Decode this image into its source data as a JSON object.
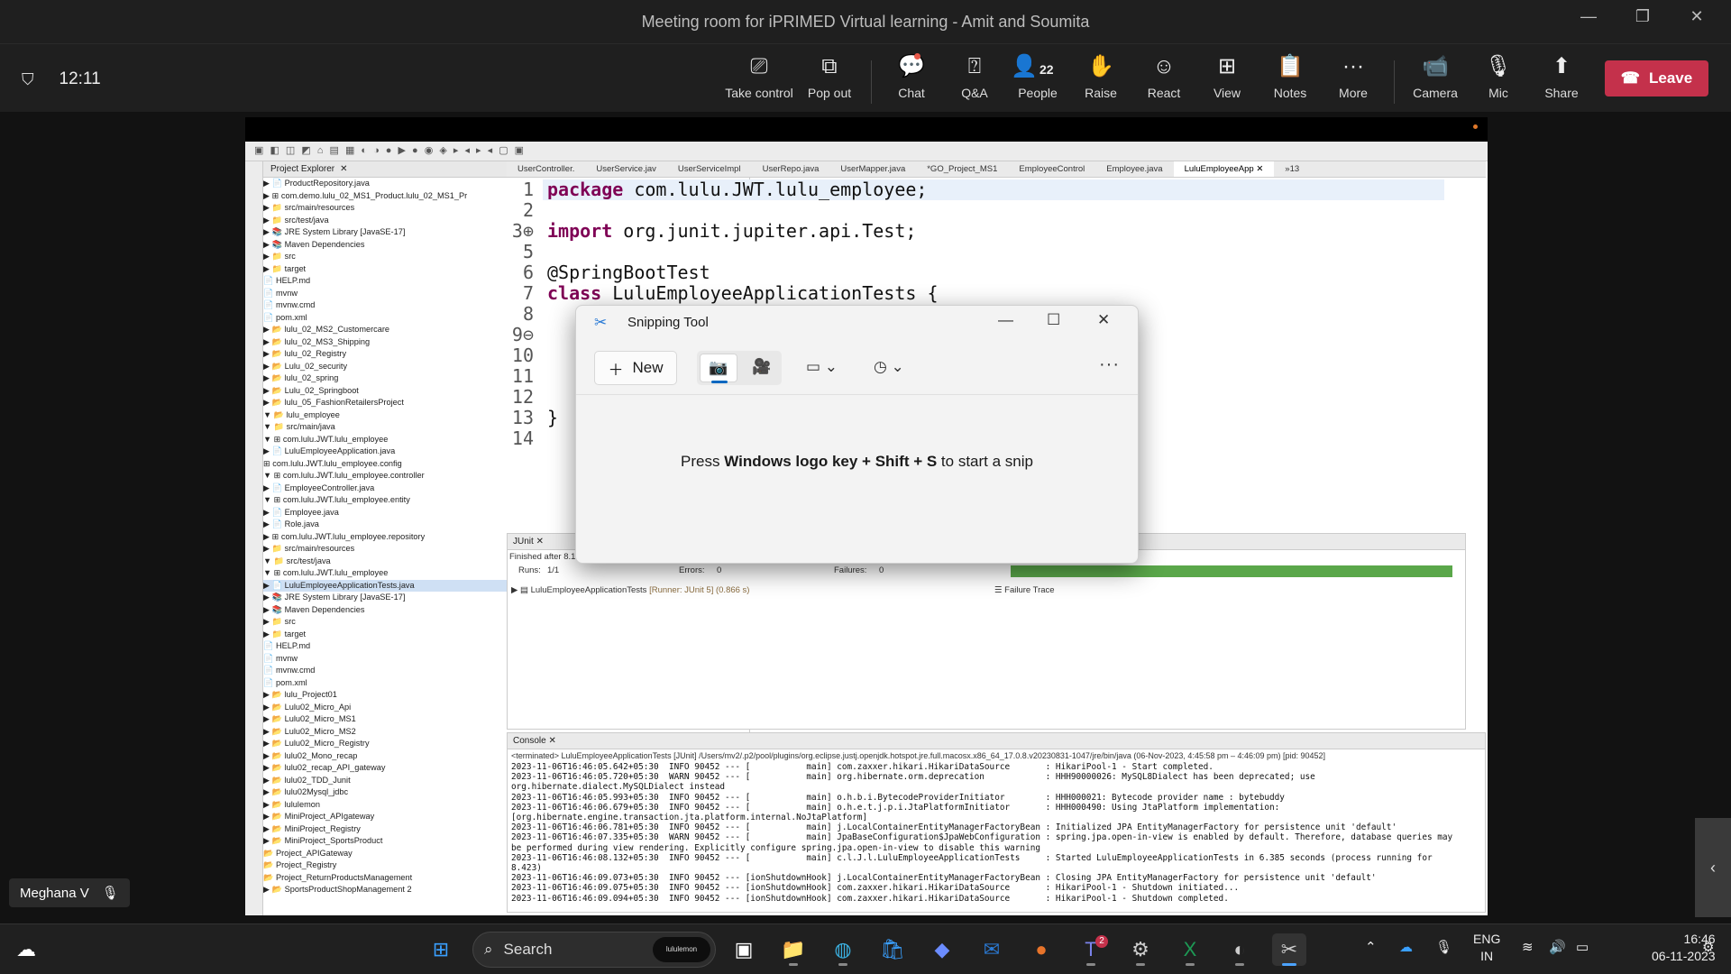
{
  "window": {
    "title": "Meeting room for iPRIMED Virtual learning - Amit and Soumita",
    "min": "—",
    "max": "❐",
    "close": "✕"
  },
  "meeting": {
    "elapsed": "12:11"
  },
  "controls": {
    "take_control": "Take control",
    "pop_out": "Pop out",
    "chat": "Chat",
    "qa": "Q&A",
    "people": "People",
    "people_count": "22",
    "raise": "Raise",
    "react": "React",
    "view": "View",
    "notes": "Notes",
    "more": "More",
    "camera": "Camera",
    "mic": "Mic",
    "share": "Share",
    "leave": "Leave"
  },
  "participant": {
    "name": "Meghana V"
  },
  "eclipse": {
    "toolbar": "▣ ◧ ◫ ◩ ⌂ ▤ ▦ ◐ ◑ ● ▶ ● ◉ ◈ ▸ ◂ ▸ ◂ ▢ ▣",
    "project_explorer": "Project Explorer",
    "tree": [
      "      ▶ 📄 ProductRepository.java",
      "      ▶ ⊞ com.demo.lulu_02_MS1_Product.lulu_02_MS1_Pr",
      "   ▶ 📁 src/main/resources",
      "   ▶ 📁 src/test/java",
      "   ▶ 📚 JRE System Library [JavaSE-17]",
      "   ▶ 📚 Maven Dependencies",
      "   ▶ 📁 src",
      "   ▶ 📁 target",
      "      📄 HELP.md",
      "      📄 mvnw",
      "      📄 mvnw.cmd",
      "      📄 pom.xml",
      " ▶ 📂 lulu_02_MS2_Customercare",
      " ▶ 📂 lulu_02_MS3_Shipping",
      " ▶ 📂 lulu_02_Registry",
      " ▶ 📂 Lulu_02_security",
      " ▶ 📂 lulu_02_spring",
      " ▶ 📂 Lulu_02_Springboot",
      " ▶ 📂 lulu_05_FashionRetailersProject",
      " ▼ 📂 lulu_employee",
      "   ▼ 📁 src/main/java",
      "     ▼ ⊞ com.lulu.JWT.lulu_employee",
      "       ▶ 📄 LuluEmployeeApplication.java",
      "       ⊞ com.lulu.JWT.lulu_employee.config",
      "     ▼ ⊞ com.lulu.JWT.lulu_employee.controller",
      "       ▶ 📄 EmployeeController.java",
      "     ▼ ⊞ com.lulu.JWT.lulu_employee.entity",
      "       ▶ 📄 Employee.java",
      "       ▶ 📄 Role.java",
      "     ▶ ⊞ com.lulu.JWT.lulu_employee.repository",
      "   ▶ 📁 src/main/resources",
      "   ▼ 📁 src/test/java",
      "     ▼ ⊞ com.lulu.JWT.lulu_employee",
      "       ▶ 📄 LuluEmployeeApplicationTests.java",
      "   ▶ 📚 JRE System Library [JavaSE-17]",
      "   ▶ 📚 Maven Dependencies",
      "   ▶ 📁 src",
      "   ▶ 📁 target",
      "      📄 HELP.md",
      "      📄 mvnw",
      "      📄 mvnw.cmd",
      "      📄 pom.xml",
      " ▶ 📂 lulu_Project01",
      " ▶ 📂 Lulu02_Micro_Api",
      " ▶ 📂 Lulu02_Micro_MS1",
      " ▶ 📂 Lulu02_Micro_MS2",
      " ▶ 📂 Lulu02_Micro_Registry",
      " ▶ 📂 lulu02_Mono_recap",
      " ▶ 📂 lulu02_recap_API_gateway",
      " ▶ 📂 lulu02_TDD_Junit",
      " ▶ 📂 lulu02Mysql_jdbc",
      " ▶ 📂 lululemon",
      " ▶ 📂 MiniProject_APIgateway",
      " ▶ 📂 MiniProject_Registry",
      " ▶ 📂 MiniProject_SportsProduct",
      "   📂 Project_APIGateway",
      "   📂 Project_Registry",
      "   📂 Project_ReturnProductsManagement",
      " ▶ 📂 SportsProductShopManagement 2"
    ],
    "tabs": [
      "UserController.",
      "UserService.jav",
      "UserServiceImpl",
      "UserRepo.java",
      "UserMapper.java",
      "*GO_Project_MS1",
      "EmployeeControl",
      "Employee.java",
      "LuluEmployeeApp ✕",
      "»13"
    ],
    "code": {
      "l1_kw": "package",
      "l1_rest": " com.lulu.JWT.lulu_employee;",
      "l3_kw": "import",
      "l3_rest": " org.junit.jupiter.api.Test;",
      "l6": "@SpringBootTest",
      "l7_kw": "class",
      "l7_rest": " LuluEmployeeApplicationTests {",
      "l13": "}"
    },
    "junit": {
      "tab": "JUnit",
      "finished": "Finished after 8.1",
      "runs_label": "Runs:",
      "runs": "1/1",
      "errors_label": "Errors:",
      "errors": "0",
      "failures_label": "Failures:",
      "failures": "0",
      "test": "LuluEmployeeApplicationTests",
      "runner": "[Runner: JUnit 5] (0.866 s)",
      "failure_trace": "Failure Trace"
    },
    "console": {
      "tab": "Console",
      "terminated": "<terminated> LuluEmployeeApplicationTests [JUnit] /Users/mv2/.p2/pool/plugins/org.eclipse.justj.openjdk.hotspot.jre.full.macosx.x86_64_17.0.8.v20230831-1047/jre/bin/java (06-Nov-2023, 4:45:58 pm – 4:46:09 pm) [pid: 90452]",
      "lines": [
        "2023-11-06T16:46:05.642+05:30  INFO 90452 --- [           main] com.zaxxer.hikari.HikariDataSource       : HikariPool-1 - Start completed.",
        "2023-11-06T16:46:05.720+05:30  WARN 90452 --- [           main] org.hibernate.orm.deprecation            : HHH90000026: MySQL8Dialect has been deprecated; use",
        "org.hibernate.dialect.MySQLDialect instead",
        "2023-11-06T16:46:05.993+05:30  INFO 90452 --- [           main] o.h.b.i.BytecodeProviderInitiator        : HHH000021: Bytecode provider name : bytebuddy",
        "2023-11-06T16:46:06.679+05:30  INFO 90452 --- [           main] o.h.e.t.j.p.i.JtaPlatformInitiator       : HHH000490: Using JtaPlatform implementation:",
        "[org.hibernate.engine.transaction.jta.platform.internal.NoJtaPlatform]",
        "2023-11-06T16:46:06.781+05:30  INFO 90452 --- [           main] j.LocalContainerEntityManagerFactoryBean : Initialized JPA EntityManagerFactory for persistence unit 'default'",
        "2023-11-06T16:46:07.335+05:30  WARN 90452 --- [           main] JpaBaseConfiguration$JpaWebConfiguration : spring.jpa.open-in-view is enabled by default. Therefore, database queries may",
        "be performed during view rendering. Explicitly configure spring.jpa.open-in-view to disable this warning",
        "2023-11-06T16:46:08.132+05:30  INFO 90452 --- [           main] c.l.J.l.LuluEmployeeApplicationTests     : Started LuluEmployeeApplicationTests in 6.385 seconds (process running for",
        "8.423)",
        "2023-11-06T16:46:09.073+05:30  INFO 90452 --- [ionShutdownHook] j.LocalContainerEntityManagerFactoryBean : Closing JPA EntityManagerFactory for persistence unit 'default'",
        "2023-11-06T16:46:09.075+05:30  INFO 90452 --- [ionShutdownHook] com.zaxxer.hikari.HikariDataSource       : HikariPool-1 - Shutdown initiated...",
        "2023-11-06T16:46:09.094+05:30  INFO 90452 --- [ionShutdownHook] com.zaxxer.hikari.HikariDataSource       : HikariPool-1 - Shutdown completed."
      ]
    }
  },
  "snipping": {
    "title": "Snipping Tool",
    "new": "New",
    "message_pre": "Press ",
    "message_key": "Windows logo key + Shift + S",
    "message_post": " to start a snip"
  },
  "taskbar": {
    "search": "Search",
    "search_pill": "lululemon",
    "lang1": "ENG",
    "lang2": "IN",
    "time": "16:46",
    "date": "06-11-2023",
    "teams_badge": "2"
  }
}
